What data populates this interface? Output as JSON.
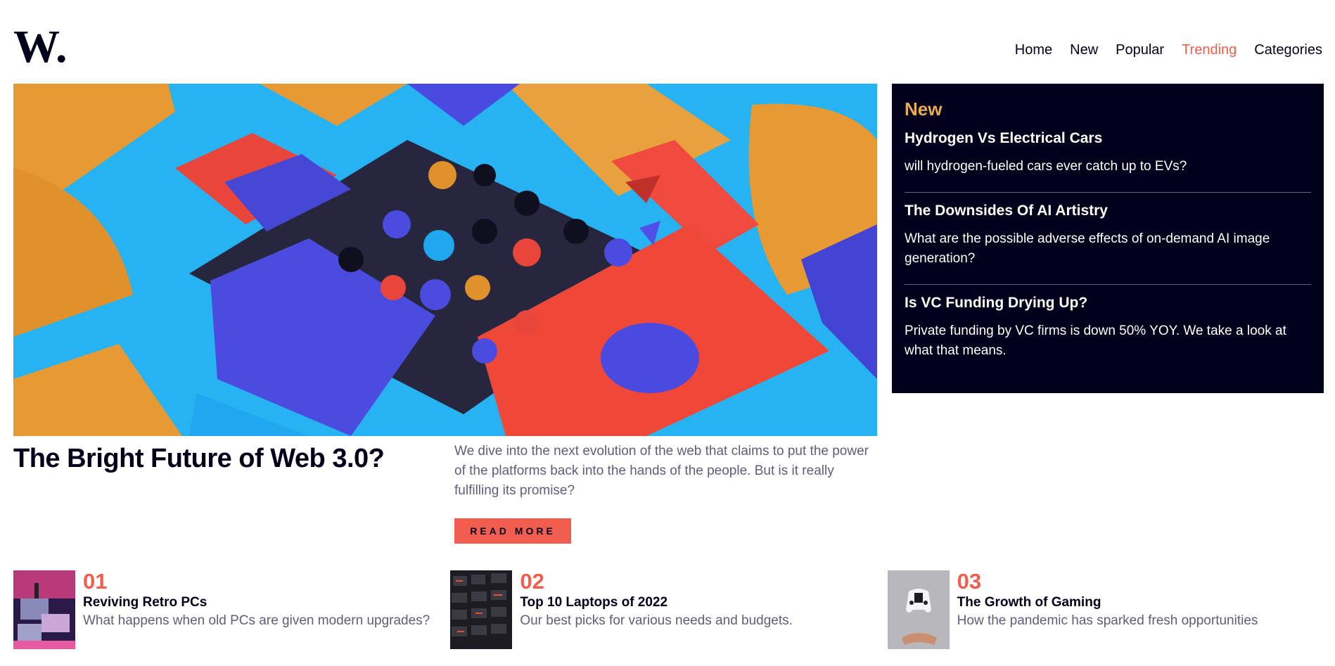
{
  "brand": {
    "logo_text": "W."
  },
  "nav": [
    {
      "label": "Home",
      "active": false
    },
    {
      "label": "New",
      "active": false
    },
    {
      "label": "Popular",
      "active": false
    },
    {
      "label": "Trending",
      "active": true
    },
    {
      "label": "Categories",
      "active": false
    }
  ],
  "hero": {
    "title": "The Bright Future of Web 3.0?",
    "description": "We dive into the next evolution of the web that claims to put the power of the platforms back into the hands of the people. But is it really fulfilling its promise?",
    "button_label": "READ MORE"
  },
  "new_panel": {
    "heading": "New",
    "items": [
      {
        "title": "Hydrogen Vs Electrical Cars",
        "description": "will hydrogen-fueled cars ever catch up to EVs?"
      },
      {
        "title": "The Downsides Of AI Artistry",
        "description": "What are the possible adverse effects of on-demand AI image generation?"
      },
      {
        "title": "Is VC Funding Drying Up?",
        "description": "Private funding by VC firms is down 50% YOY. We take a look at what that means."
      }
    ]
  },
  "bottom": [
    {
      "number": "01",
      "title": "Reviving Retro PCs",
      "description": "What happens when old PCs are given modern upgrades?"
    },
    {
      "number": "02",
      "title": "Top 10 Laptops of 2022",
      "description": "Our best picks for various needs and budgets."
    },
    {
      "number": "03",
      "title": "The Growth of Gaming",
      "description": "How the pandemic has sparked fresh opportunities"
    }
  ],
  "colors": {
    "accent": "#f15e50",
    "dark": "#00001a",
    "new_heading": "#e9ab53",
    "muted": "#5d5f79"
  }
}
